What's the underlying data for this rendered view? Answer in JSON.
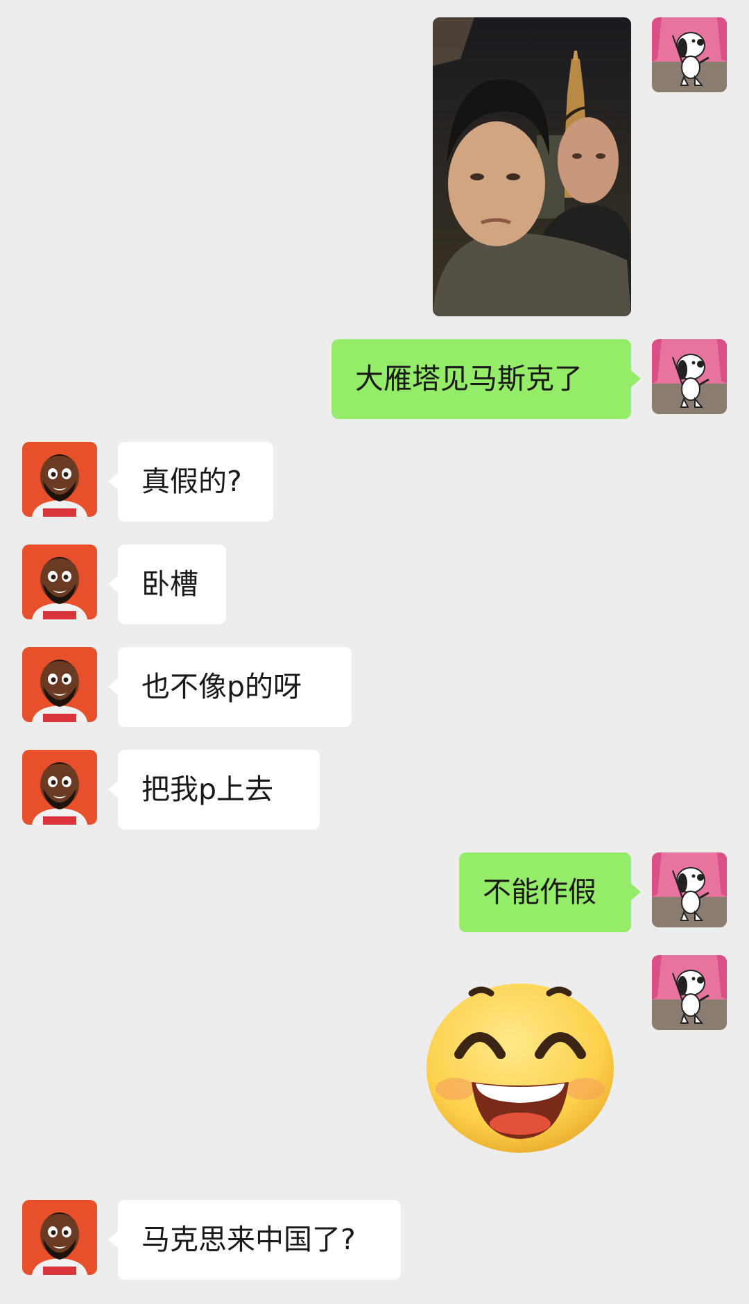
{
  "messages": [
    {
      "side": "right",
      "type": "image",
      "description": "photo"
    },
    {
      "side": "right",
      "type": "text",
      "text": "大雁塔见马斯克了"
    },
    {
      "side": "left",
      "type": "text",
      "text": "真假的?"
    },
    {
      "side": "left",
      "type": "text",
      "text": "卧槽"
    },
    {
      "side": "left",
      "type": "text",
      "text": "也不像p的呀"
    },
    {
      "side": "left",
      "type": "text",
      "text": "把我p上去"
    },
    {
      "side": "right",
      "type": "text",
      "text": "不能作假"
    },
    {
      "side": "right",
      "type": "sticker",
      "icon": "grinning-face-sticker"
    },
    {
      "side": "left",
      "type": "text",
      "text": "马克思来中国了?"
    }
  ],
  "avatars": {
    "self": "snoopy-avatar-icon",
    "contact": "cartoon-man-avatar-icon"
  },
  "colors": {
    "background": "#ededed",
    "self_bubble": "#95ec69",
    "contact_bubble": "#ffffff"
  }
}
